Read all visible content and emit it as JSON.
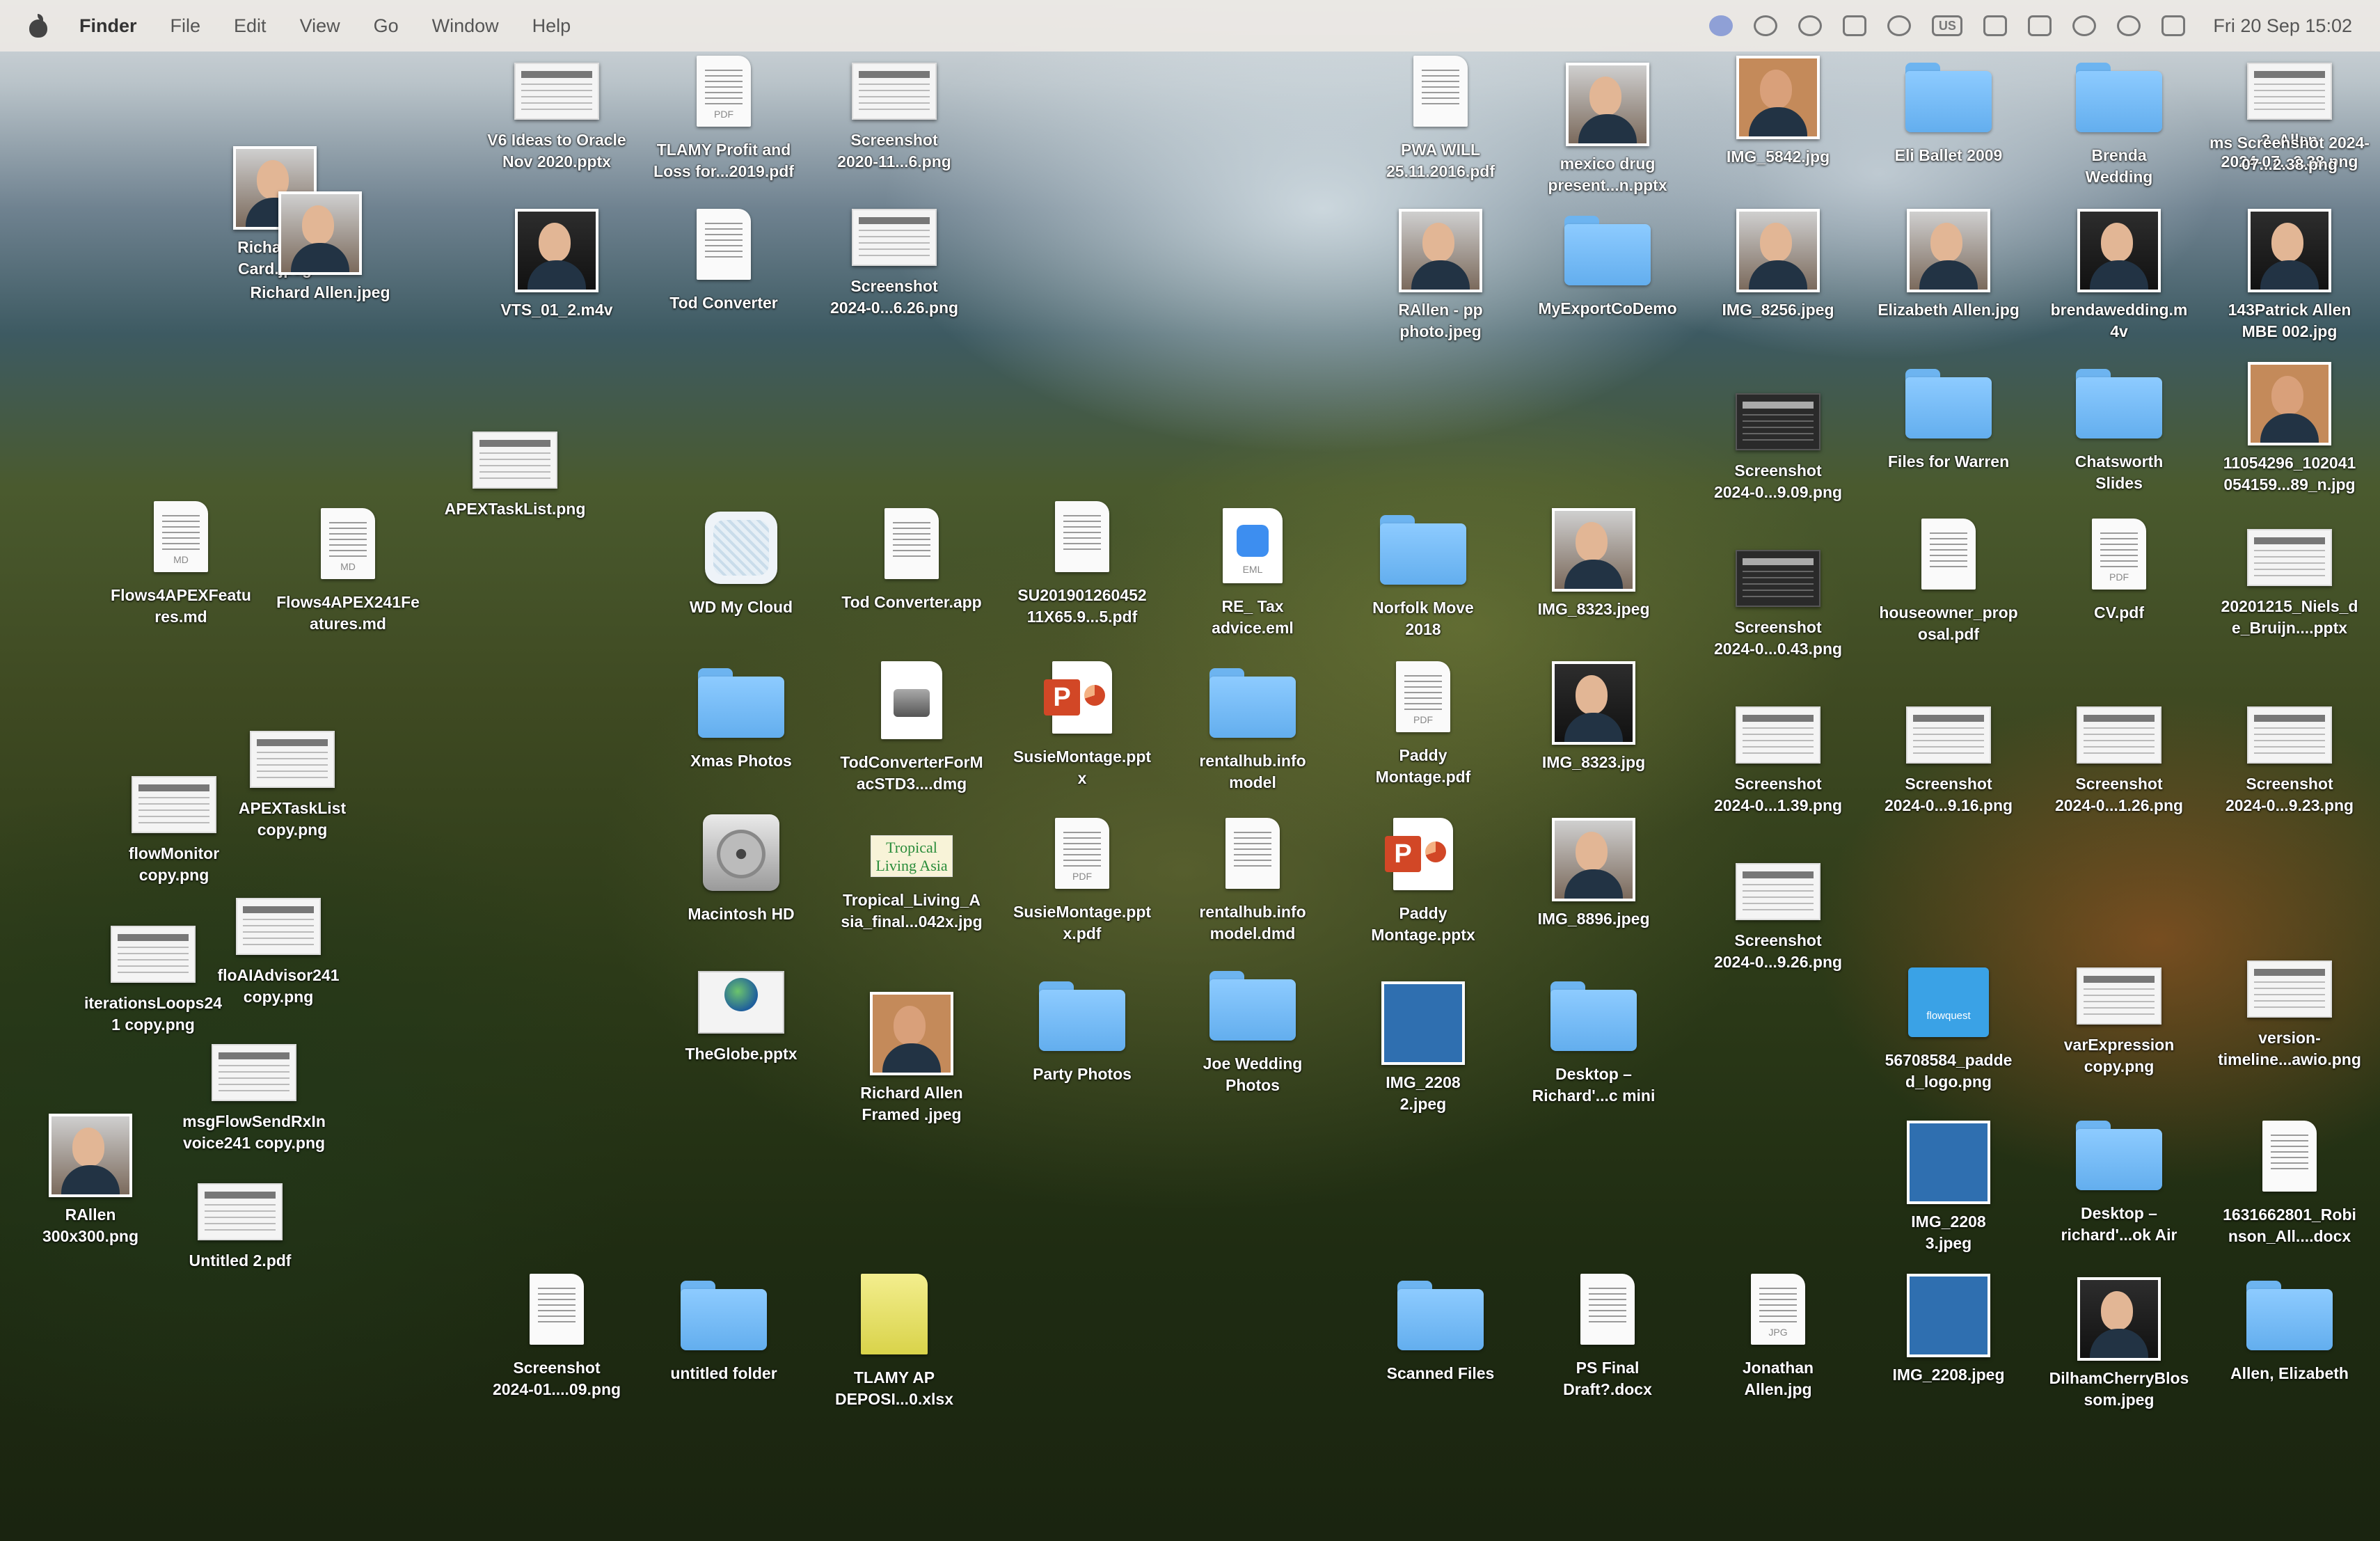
{
  "menubar": {
    "app": "Finder",
    "items": [
      "File",
      "Edit",
      "View",
      "Go",
      "Window",
      "Help"
    ],
    "status_icons": [
      "zoom-icon",
      "openai-icon",
      "waveform-icon",
      "clipboard-icon",
      "play-icon",
      "keyboard-input-icon",
      "battery-person-icon",
      "battery-icon",
      "wifi-icon",
      "search-icon",
      "control-center-icon"
    ],
    "input_source": "US",
    "clock": "Fri 20 Sep  15:02"
  },
  "desktop": {
    "items": [
      {
        "name": "V6 Ideas to Oracle\nNov 2020.pptx",
        "kind": "shot"
      },
      {
        "name": "TLAMY Profit and\nLoss for...2019.pdf",
        "kind": "doc",
        "tag": "PDF"
      },
      {
        "name": "Screenshot\n2020-11...6.png",
        "kind": "shot"
      },
      {
        "name": "PWA WILL\n25.11.2016.pdf",
        "kind": "doc"
      },
      {
        "name": "mexico drug\npresent...n.pptx",
        "kind": "photo"
      },
      {
        "name": "IMG_5842.jpg",
        "kind": "photo-framed"
      },
      {
        "name": "Eli Ballet 2009",
        "kind": "folder"
      },
      {
        "name": "Brenda\nWedding",
        "kind": "folder"
      },
      {
        "name": "3. Allen\n2024-07...2.38.png",
        "kind": "shot"
      },
      {
        "name": "ms Screenshot 2024-07...2.38.png",
        "kind": "label"
      },
      {
        "name": "Richard A\nCard.jpeg",
        "kind": "photo"
      },
      {
        "name": "Richard Allen.jpeg",
        "kind": "photo"
      },
      {
        "name": "VTS_01_2.m4v",
        "kind": "photo-dark"
      },
      {
        "name": "Tod Converter",
        "kind": "doc"
      },
      {
        "name": "Screenshot\n2024-0...6.26.png",
        "kind": "shot"
      },
      {
        "name": "RAllen - pp\nphoto.jpeg",
        "kind": "photo"
      },
      {
        "name": "MyExportCoDemo",
        "kind": "folder"
      },
      {
        "name": "IMG_8256.jpeg",
        "kind": "photo"
      },
      {
        "name": "Elizabeth Allen.jpg",
        "kind": "photo"
      },
      {
        "name": "brendawedding.m\n4v",
        "kind": "photo-dark"
      },
      {
        "name": "143Patrick Allen\nMBE 002.jpg",
        "kind": "photo-dark"
      },
      {
        "name": "APEXTaskList.png",
        "kind": "shot"
      },
      {
        "name": "Screenshot\n2024-0...9.09.png",
        "kind": "shot-dark"
      },
      {
        "name": "Files for Warren",
        "kind": "folder"
      },
      {
        "name": "Chatsworth\nSlides",
        "kind": "folder"
      },
      {
        "name": "11054296_102041\n054159...89_n.jpg",
        "kind": "photo-framed"
      },
      {
        "name": "Flows4APEXFeatu\nres.md",
        "kind": "doc",
        "tag": "MD"
      },
      {
        "name": "Flows4APEX241Fe\natures.md",
        "kind": "doc",
        "tag": "MD"
      },
      {
        "name": "WD My Cloud",
        "kind": "wd"
      },
      {
        "name": "Tod Converter.app",
        "kind": "doc"
      },
      {
        "name": "SU201901260452\n11X65.9...5.pdf",
        "kind": "doc"
      },
      {
        "name": "RE_ Tax\nadvice.eml",
        "kind": "eml",
        "tag": "EML"
      },
      {
        "name": "Norfolk Move\n2018",
        "kind": "folder"
      },
      {
        "name": "IMG_8323.jpeg",
        "kind": "photo"
      },
      {
        "name": "Screenshot\n2024-0...0.43.png",
        "kind": "shot-dark"
      },
      {
        "name": "houseowner_prop\nosal.pdf",
        "kind": "doc"
      },
      {
        "name": "CV.pdf",
        "kind": "doc",
        "tag": "PDF"
      },
      {
        "name": "20201215_Niels_d\ne_Bruijn....pptx",
        "kind": "shot"
      },
      {
        "name": "APEXTaskList\ncopy.png",
        "kind": "shot"
      },
      {
        "name": "flowMonitor\ncopy.png",
        "kind": "shot"
      },
      {
        "name": "Xmas Photos",
        "kind": "folder"
      },
      {
        "name": "TodConverterForM\nacSTD3....dmg",
        "kind": "dmg"
      },
      {
        "name": "SusieMontage.ppt\nx",
        "kind": "pptx",
        "tag": "P"
      },
      {
        "name": "rentalhub.info\nmodel",
        "kind": "folder"
      },
      {
        "name": "Paddy\nMontage.pdf",
        "kind": "doc",
        "tag": "PDF"
      },
      {
        "name": "IMG_8323.jpg",
        "kind": "photo-dark"
      },
      {
        "name": "Screenshot\n2024-0...1.39.png",
        "kind": "shot"
      },
      {
        "name": "Screenshot\n2024-0...9.16.png",
        "kind": "shot"
      },
      {
        "name": "Screenshot\n2024-0...1.26.png",
        "kind": "shot"
      },
      {
        "name": "Screenshot\n2024-0...9.23.png",
        "kind": "shot"
      },
      {
        "name": "floAIAdvisor241\ncopy.png",
        "kind": "shot"
      },
      {
        "name": "iterationsLoops24\n1 copy.png",
        "kind": "shot"
      },
      {
        "name": "Macintosh HD",
        "kind": "disk"
      },
      {
        "name": "Tropical_Living_A\nsia_final...042x.jpg",
        "kind": "tropical",
        "tag": "Tropical Living Asia"
      },
      {
        "name": "SusieMontage.ppt\nx.pdf",
        "kind": "doc",
        "tag": "PDF"
      },
      {
        "name": "rentalhub.info\nmodel.dmd",
        "kind": "doc"
      },
      {
        "name": "Paddy\nMontage.pptx",
        "kind": "pptx",
        "tag": "P"
      },
      {
        "name": "IMG_8896.jpeg",
        "kind": "photo"
      },
      {
        "name": "Screenshot\n2024-0...9.26.png",
        "kind": "shot"
      },
      {
        "name": "msgFlowSendRxIn\nvoice241 copy.png",
        "kind": "shot"
      },
      {
        "name": "RAllen\n300x300.png",
        "kind": "photo"
      },
      {
        "name": "Untitled 2.pdf",
        "kind": "shot"
      },
      {
        "name": "TheGlobe.pptx",
        "kind": "globe",
        "tag": "The Globe"
      },
      {
        "name": "Richard Allen\nFramed .jpeg",
        "kind": "photo-framed"
      },
      {
        "name": "Party Photos",
        "kind": "folder"
      },
      {
        "name": "Joe Wedding\nPhotos",
        "kind": "folder"
      },
      {
        "name": "IMG_2208\n2.jpeg",
        "kind": "photo-blue"
      },
      {
        "name": "Desktop –\nRichard'...c mini",
        "kind": "folder"
      },
      {
        "name": "56708584_padde\nd_logo.png",
        "kind": "qr",
        "tag": "flowquest"
      },
      {
        "name": "varExpression\ncopy.png",
        "kind": "shot"
      },
      {
        "name": "version-\ntimeline...awio.png",
        "kind": "shot"
      },
      {
        "name": "IMG_2208\n3.jpeg",
        "kind": "photo-blue"
      },
      {
        "name": "Desktop –\nrichard'...ok Air",
        "kind": "folder"
      },
      {
        "name": "1631662801_Robi\nnson_All....docx",
        "kind": "doc"
      },
      {
        "name": "Screenshot\n2024-01....09.png",
        "kind": "doc"
      },
      {
        "name": "untitled folder",
        "kind": "folder"
      },
      {
        "name": "TLAMY AP\nDEPOSI...0.xlsx",
        "kind": "xlsx"
      },
      {
        "name": "Scanned Files",
        "kind": "folder"
      },
      {
        "name": "PS Final\nDraft?.docx",
        "kind": "doc"
      },
      {
        "name": "Jonathan\nAllen.jpg",
        "kind": "doc",
        "tag": "JPG"
      },
      {
        "name": "IMG_2208.jpeg",
        "kind": "photo-blue"
      },
      {
        "name": "DilhamCherryBlos\nsom.jpeg",
        "kind": "photo-dark"
      },
      {
        "name": "Allen, Elizabeth",
        "kind": "folder"
      }
    ]
  }
}
